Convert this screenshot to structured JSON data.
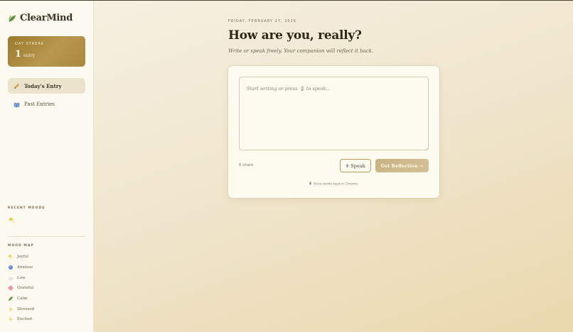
{
  "brand": {
    "name": "ClearMind",
    "icon": "leaf-icon"
  },
  "streak": {
    "label": "DAY STREAK",
    "count": "1",
    "unit": "entry"
  },
  "nav": [
    {
      "label": "Today's Entry",
      "icon": "pencil-icon",
      "active": true
    },
    {
      "label": "Past Entries",
      "icon": "book-icon",
      "active": false
    }
  ],
  "recent_moods": {
    "title": "RECENT MOODS",
    "items": [
      "joyful"
    ]
  },
  "mood_map": {
    "title": "MOOD MAP",
    "items": [
      {
        "label": "Joyful",
        "icon": "sun-cloud-icon",
        "color": "#f1c94d"
      },
      {
        "label": "Anxious",
        "icon": "blue-circle-icon",
        "color": "#6b88d6"
      },
      {
        "label": "Low",
        "icon": "cloud-icon",
        "color": "#d7dde6"
      },
      {
        "label": "Grateful",
        "icon": "flower-icon",
        "color": "#e67fa0"
      },
      {
        "label": "Calm",
        "icon": "leaf-icon",
        "color": "#5d9b48"
      },
      {
        "label": "Stressed",
        "icon": "lightning-icon",
        "color": "#f4c542"
      },
      {
        "label": "Excited",
        "icon": "sparkle-icon",
        "color": "#f3d36a"
      }
    ]
  },
  "main": {
    "date": "FRIDAY, FEBRUARY 27, 2026",
    "title": "How are you, really?",
    "subtitle": "Write or speak freely. Your companion will reflect it back.",
    "placeholder": "Start writing or press 🎙 to speak...",
    "chars": "0 chars",
    "speak_label": "Speak",
    "reflect_label": "Get Reflection →",
    "voice_note": "Voice works best in Chrome."
  },
  "colors": {
    "accent": "#a8883e",
    "sidebar": "#fcf9f0"
  }
}
